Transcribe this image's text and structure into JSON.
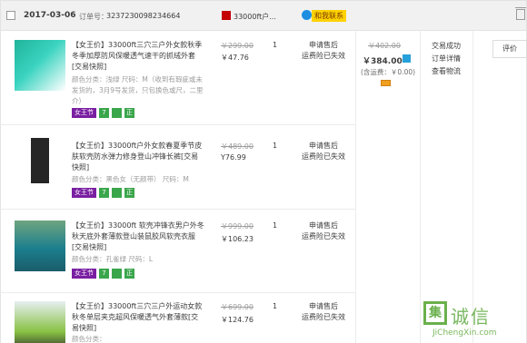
{
  "order": {
    "date": "2017-03-06",
    "order_no_label": "订单号：",
    "order_no": "3237230098234664",
    "shop_name": "33000ft户...",
    "contact_label": "和我联系"
  },
  "items": [
    {
      "title": "【女王价】33000ft三穴三户外女款秋季冬季加厚防风保暖透气速干的抓绒外套[交易快照]",
      "sku": "颜色分类：浅绿 尺码：M（收到有瑕疵或未发货的，3月9号发货，只包换色或尺，二里介）",
      "orig_price": "￥299.00",
      "price": "￥47.76",
      "qty": "1",
      "service_1": "申请售后",
      "service_2": "运费险已失效",
      "badge_fest": "女王节",
      "badge_seven": "7",
      "badge_zheng": "正"
    },
    {
      "title": "【女王价】33000ft户外女款春夏季节皮肤软壳防水弹力修身登山冲锋长裤[交易快照]",
      "sku": "颜色分类：黑色女（无颜带） 尺码：M",
      "orig_price": "￥489.00",
      "price": "Y76.99",
      "qty": "1",
      "service_1": "申请售后",
      "service_2": "运费险已失效",
      "badge_fest": "女王节",
      "badge_seven": "7",
      "badge_zheng": "正"
    },
    {
      "title": "【女王价】33000ft 软壳冲锋衣男户外冬秋天底外套薄款登山装鼠胶风软壳衣服[交易快照]",
      "sku": "颜色分类：孔雀绿 尺码：L",
      "orig_price": "￥999.00",
      "price": "￥106.23",
      "qty": "1",
      "service_1": "申请售后",
      "service_2": "运费险已失效",
      "badge_fest": "女王节",
      "badge_seven": "7",
      "badge_zheng": "正"
    },
    {
      "title": "【女王价】33000ft三穴三户外运动女款秋冬单层夹克超风保暖透气外套薄款[交易快照]",
      "sku": "颜色分类：",
      "orig_price": "￥699.00",
      "price": "￥124.76",
      "qty": "1",
      "service_1": "申请售后",
      "service_2": "运费险已失效"
    }
  ],
  "totals": {
    "orig_total": "￥402.00",
    "total": "￥384.00",
    "shipping": "(含运费：￥0.00)"
  },
  "status": {
    "line_1": "交易成功",
    "line_2": "订单详情",
    "line_3": "查看物流"
  },
  "actions": {
    "evaluate_label": "评价"
  },
  "watermark": {
    "box_char": "集",
    "text": "诚信",
    "url": "JiChengXin.com"
  },
  "colors": {
    "header_bg": "#f1f1f1",
    "festival_badge": "#7a1fa2",
    "service_badge": "#3aa64b",
    "contact_badge": "#ffd200",
    "watermark": "#6ab04c"
  }
}
